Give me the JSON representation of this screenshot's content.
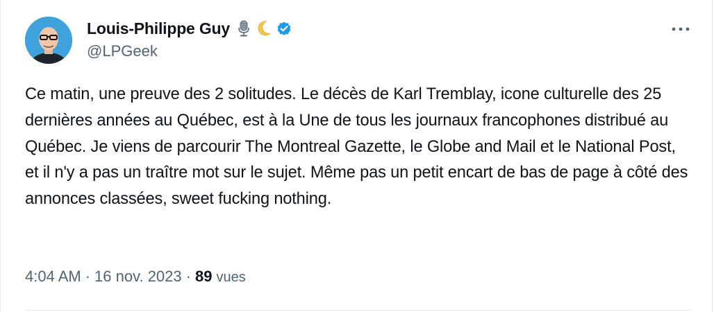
{
  "author": {
    "display_name": "Louis-Philippe Guy",
    "handle": "@LPGeek",
    "name_emojis": [
      "microphone-icon",
      "crescent-moon-icon"
    ],
    "verified": true
  },
  "tweet": {
    "text": "Ce matin, une preuve des 2 solitudes. Le décès de Karl Tremblay, icone culturelle des 25 dernières années au Québec, est à la Une de tous les journaux francophones distribué au Québec. Je viens de parcourir The Montreal Gazette, le Globe and Mail et le National Post, et il n'y a pas un traître mot sur le sujet. Même pas un petit encart de bas de page à côté des annonces classées, sweet fucking nothing."
  },
  "meta": {
    "time": "4:04 AM",
    "date": "16 nov. 2023",
    "separator": "·",
    "views_count": "89",
    "views_label": "vues"
  },
  "colors": {
    "text_primary": "#0f1419",
    "text_secondary": "#536471",
    "verified_blue": "#1d9bf0"
  }
}
